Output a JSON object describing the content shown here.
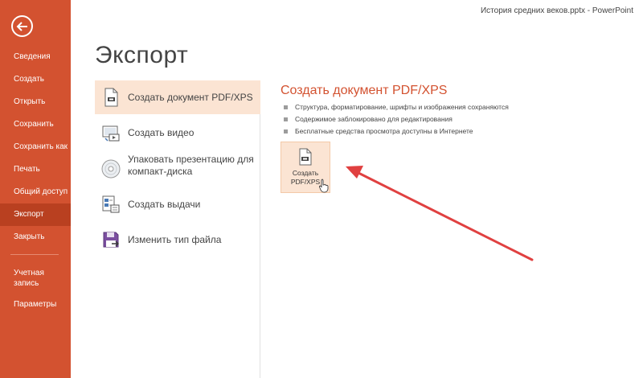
{
  "window": {
    "title": "История средних веков.pptx - PowerPoint"
  },
  "sidebar": {
    "items": [
      {
        "label": "Сведения"
      },
      {
        "label": "Создать"
      },
      {
        "label": "Открыть"
      },
      {
        "label": "Сохранить"
      },
      {
        "label": "Сохранить как"
      },
      {
        "label": "Печать"
      },
      {
        "label": "Общий доступ"
      },
      {
        "label": "Экспорт",
        "active": true
      },
      {
        "label": "Закрыть"
      }
    ],
    "bottom_items": [
      {
        "label": "Учетная запись"
      },
      {
        "label": "Параметры"
      }
    ],
    "colors": {
      "background": "#d35230",
      "active": "#b94020"
    }
  },
  "main": {
    "title": "Экспорт",
    "options": [
      {
        "label": "Создать документ PDF/XPS",
        "icon": "pdf-document-icon",
        "selected": true
      },
      {
        "label": "Создать видео",
        "icon": "video-icon"
      },
      {
        "label": "Упаковать презентацию для компакт-диска",
        "icon": "cd-disc-icon"
      },
      {
        "label": "Создать выдачи",
        "icon": "handouts-icon"
      },
      {
        "label": "Изменить тип файла",
        "icon": "save-as-type-icon"
      }
    ]
  },
  "detail": {
    "title": "Создать документ PDF/XPS",
    "bullets": [
      "Структура, форматирование, шрифты и изображения сохраняются",
      "Содержимое заблокировано для редактирования",
      "Бесплатные средства просмотра доступны в Интернете"
    ],
    "button": {
      "label_line1": "Создать",
      "label_line2": "PDF/XPS",
      "icon": "pdf-document-icon"
    }
  },
  "annotation": {
    "arrow_color": "#e04040",
    "cursor_icon": "hand-pointer-icon"
  }
}
